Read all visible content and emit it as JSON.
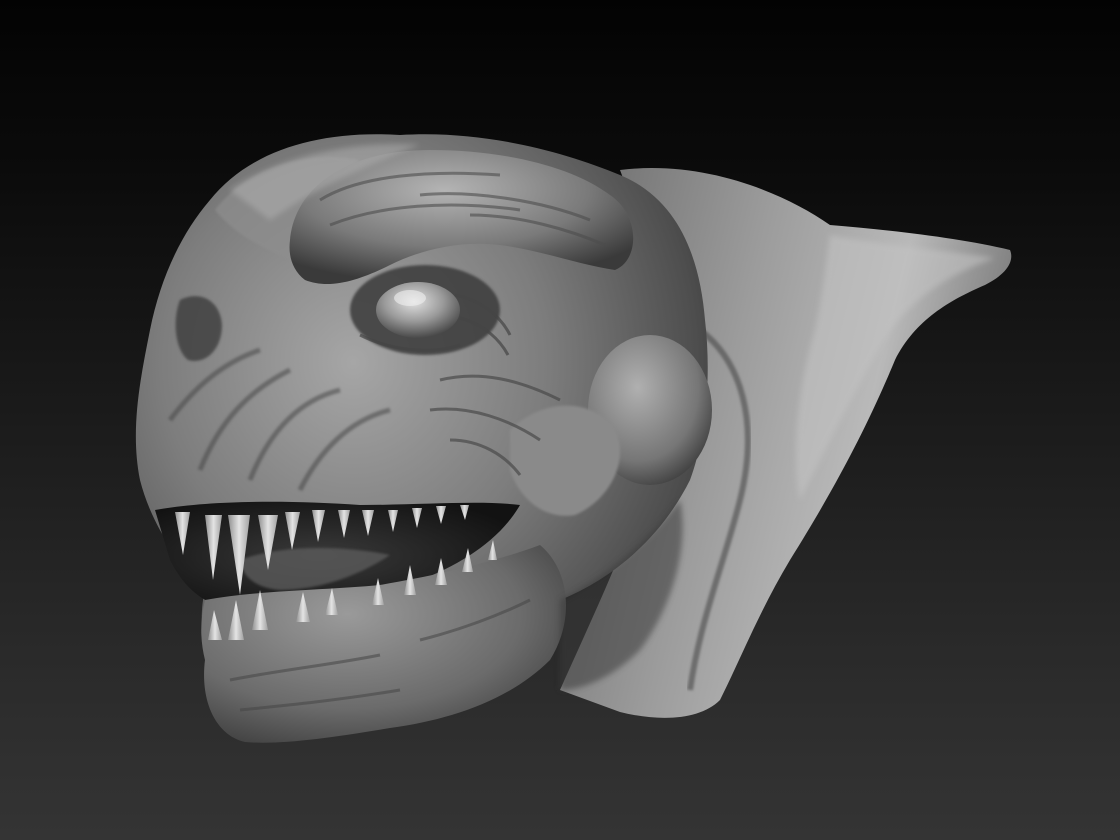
{
  "viewport": {
    "background_top": "#030303",
    "background_bottom": "#343434",
    "model_base_color": "#8a8a8a",
    "model_highlight_color": "#cfcfcf",
    "model_shadow_color": "#1e1e1e"
  },
  "model": {
    "subject": "creature-head-sculpt",
    "material": "matcap-grey"
  }
}
